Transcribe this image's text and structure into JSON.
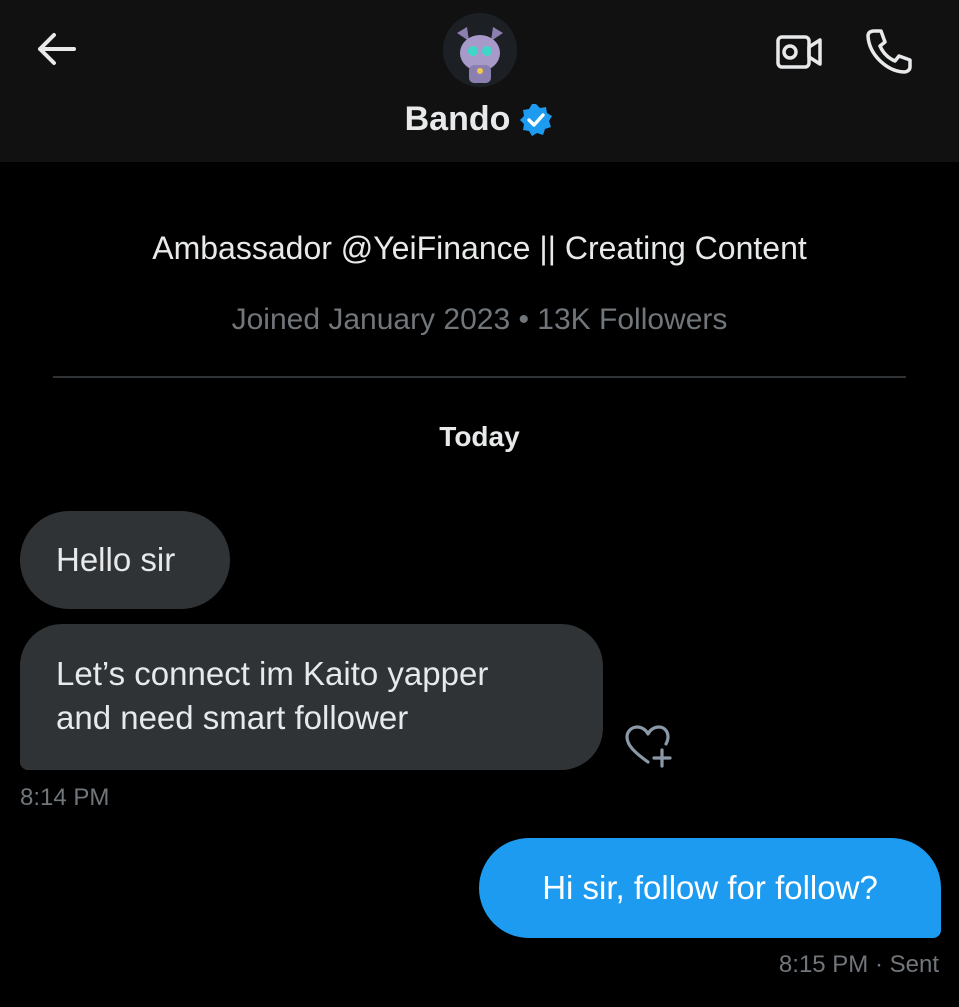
{
  "header": {
    "name": "Bando",
    "verified": true,
    "accent": "#1d9bf0",
    "icons": [
      "back-arrow-icon",
      "video-call-icon",
      "phone-icon",
      "verified-badge-icon"
    ]
  },
  "profile": {
    "bio": "Ambassador @YeiFinance || Creating Content",
    "meta": "Joined January 2023 • 13K Followers"
  },
  "conversation": {
    "date_separator": "Today",
    "incoming": [
      {
        "text": "Hello sir"
      },
      {
        "text": "Let’s connect im Kaito yapper\nand need smart follower"
      }
    ],
    "incoming_time": "8:14 PM",
    "outgoing": [
      {
        "text": "Hi sir, follow for follow?"
      }
    ],
    "outgoing_time": "8:15 PM · Sent"
  },
  "colors": {
    "background": "#000000",
    "header_bg": "#111111",
    "incoming_bubble": "#2f3336",
    "outgoing_bubble": "#1d9bf0",
    "muted_text": "#71767b"
  }
}
